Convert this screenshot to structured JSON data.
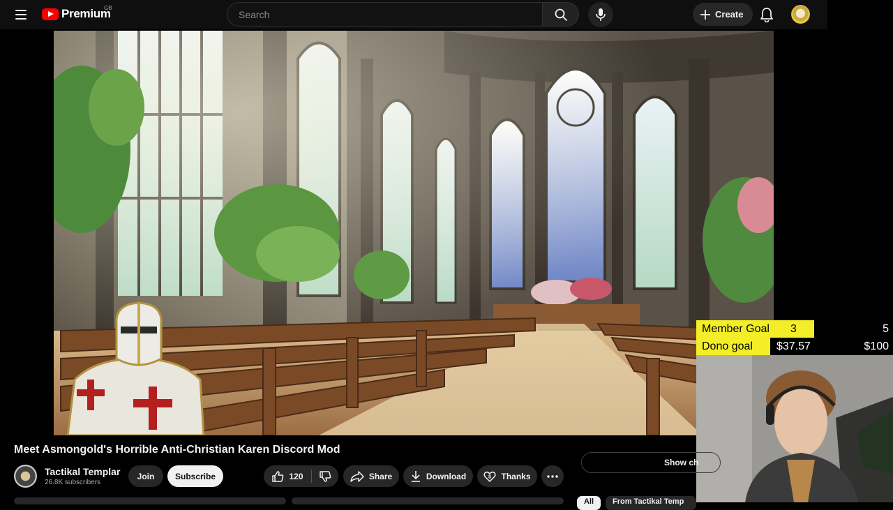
{
  "masthead": {
    "logo_text": "Premium",
    "country_code": "GB",
    "search_placeholder": "Search",
    "create_label": "Create"
  },
  "icons": {
    "menu": "menu-icon",
    "search": "search-icon",
    "mic": "microphone-icon",
    "create": "plus-icon",
    "notifications": "bell-icon",
    "like": "thumbs-up-icon",
    "dislike": "thumbs-down-icon",
    "share": "share-icon",
    "download": "download-icon",
    "thanks": "thanks-heart-icon",
    "more": "more-horizontal-icon"
  },
  "overlay": {
    "member_goal": {
      "label": "Member Goal",
      "current": "3",
      "target": "5",
      "fraction": 0.6
    },
    "dono_goal": {
      "label": "Dono goal",
      "current": "$37.57",
      "target": "$100",
      "fraction": 0.3757
    }
  },
  "video": {
    "title": "Meet Asmongold's Horrible Anti-Christian Karen Discord Mod"
  },
  "channel": {
    "name": "Tactikal Templar",
    "subscribers": "26.8K subscribers"
  },
  "actions": {
    "join": "Join",
    "subscribe": "Subscribe",
    "like_count": "120",
    "share": "Share",
    "download": "Download",
    "thanks": "Thanks"
  },
  "sidebar": {
    "show_chat": "Show ch",
    "chips": [
      "All",
      "From Tactikal Temp"
    ]
  },
  "colors": {
    "masthead_bg": "#0f0f0f",
    "brand_red": "#ff0000",
    "goal_yellow": "#f3ee27",
    "pill_bg": "#272727"
  }
}
